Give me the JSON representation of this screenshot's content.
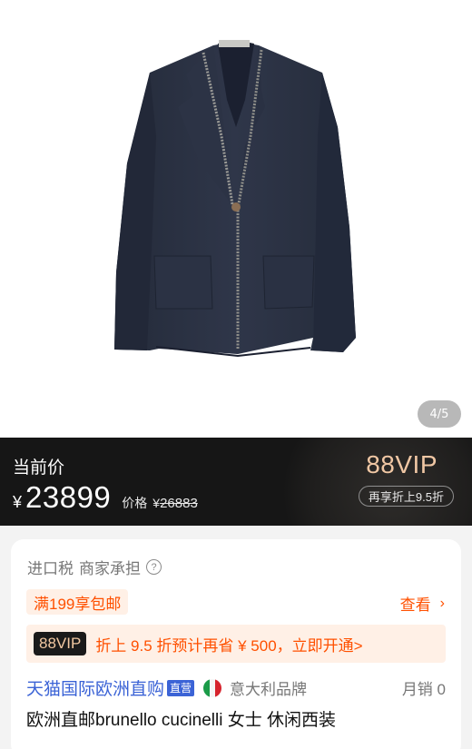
{
  "gallery": {
    "image_alt": "navy linen blazer",
    "page_indicator": "4/5"
  },
  "price": {
    "label": "当前价",
    "currency": "¥",
    "amount": "23899",
    "original_label": "价格",
    "original_currency": "¥",
    "original_amount": "26883",
    "vip_title": "88VIP",
    "vip_pill": "再享折上9.5折"
  },
  "card": {
    "tax_text": "进口税",
    "tax_sub": "商家承担",
    "shipping_tag": "满199享包邮",
    "view_more": "查看",
    "vip_badge": "88VIP",
    "vip_offer": "折上 9.5 折预计再省 ¥ 500，立即开通>",
    "store_name": "天猫国际欧洲直购",
    "direct_badge": "直营",
    "origin": "意大利品牌",
    "sales": "月销 0",
    "product_title": "欧洲直邮brunello cucinelli 女士 休闲西装"
  },
  "colors": {
    "accent": "#ff5000",
    "link_blue": "#3b63d6",
    "vip_gold": "#f0c7a4",
    "banner_bg": "#161616"
  },
  "icons": [
    "help-icon",
    "chevron-right-icon",
    "italy-flag-icon"
  ]
}
